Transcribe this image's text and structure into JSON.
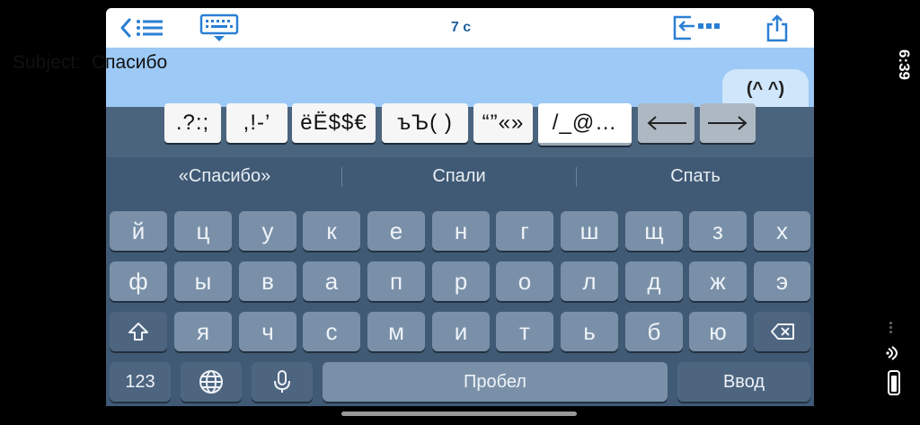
{
  "status": {
    "time": "6:39"
  },
  "toolbar": {
    "title": "7 c"
  },
  "subject": {
    "label": "Subject:",
    "value": "Спасибо"
  },
  "emoticon_tab": {
    "label": "(^ ^)"
  },
  "symbol_bar": [
    ".?:;",
    ",!-’",
    "ёЁ$$€",
    "ъЪ( )",
    "“”«»",
    "/_@…"
  ],
  "suggestions": [
    "«Спасибо»",
    "Спали",
    "Спать"
  ],
  "keyboard": {
    "row1": [
      "й",
      "ц",
      "у",
      "к",
      "е",
      "н",
      "г",
      "ш",
      "щ",
      "з",
      "х"
    ],
    "row2": [
      "ф",
      "ы",
      "в",
      "а",
      "п",
      "р",
      "о",
      "л",
      "д",
      "ж",
      "э"
    ],
    "row3": [
      "я",
      "ч",
      "с",
      "м",
      "и",
      "т",
      "ь",
      "б",
      "ю"
    ],
    "numbers_key": "123",
    "space_label": "Пробел",
    "return_label": "Ввод"
  },
  "colors": {
    "accent": "#2a7fd4",
    "subject_bg": "#9cc9f5",
    "keyboard_bg": "#405a75"
  },
  "icons": [
    "back-chevron-icon",
    "list-icon",
    "keyboard-icon",
    "sidebar-toggle-icon",
    "share-icon",
    "arrow-left-icon",
    "arrow-right-icon",
    "shift-icon",
    "delete-icon",
    "globe-icon",
    "microphone-icon",
    "battery-icon"
  ]
}
